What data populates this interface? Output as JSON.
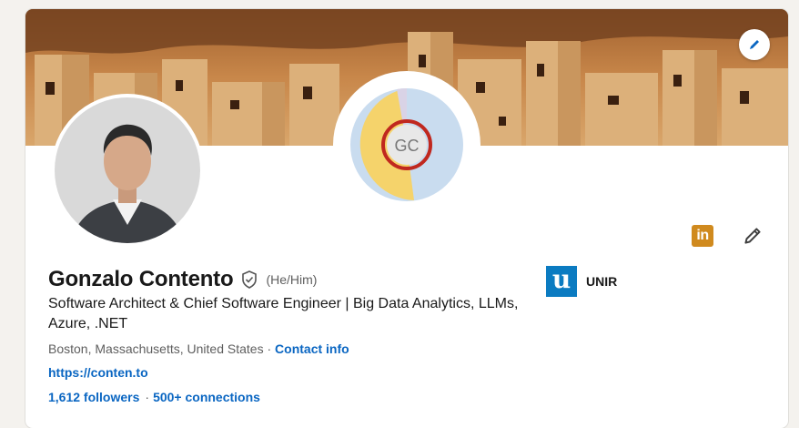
{
  "profile": {
    "name": "Gonzalo Contento",
    "pronouns": "(He/Him)",
    "headline": "Software Architect & Chief Software Engineer | Big Data Analytics, LLMs, Azure, .NET",
    "location": "Boston, Massachusetts, United States",
    "location_separator": " · ",
    "contact_info_label": "Contact info",
    "website": "https://conten.to",
    "followers": "1,612 followers",
    "stats_separator": "·",
    "connections": "500+ connections",
    "center_logo_initials": "GC"
  },
  "education": {
    "logo_letter": "u",
    "name": "UNIR"
  },
  "actions": {
    "linkedin_icon_text": "in"
  },
  "icons": {
    "edit_banner": "pencil-icon",
    "verified": "shield-check-icon",
    "edit_intro": "pencil-icon",
    "linkedin": "linkedin-icon"
  },
  "colors": {
    "link": "#0a66c2",
    "text": "#191919",
    "muted": "#5e5e5e",
    "linkedin_orange": "#d08a1e",
    "unir_blue": "#0b7bc1"
  }
}
